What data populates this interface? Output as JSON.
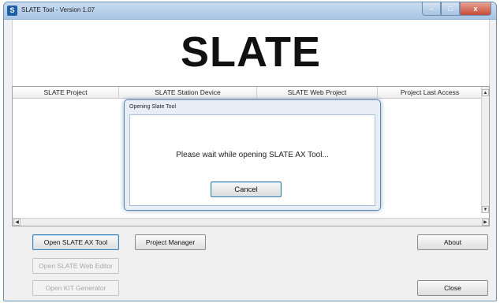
{
  "window": {
    "title": "SLATE Tool - Version 1.07",
    "app_icon_letter": "S",
    "controls": {
      "minimize": "–",
      "maximize": "□",
      "close": "x"
    }
  },
  "banner": {
    "title": "SLATE"
  },
  "list": {
    "columns": [
      "SLATE Project",
      "SLATE Station Device",
      "SLATE Web Project",
      "Project Last Access"
    ],
    "scroll_up": "▲",
    "scroll_down": "▼",
    "scroll_left": "◀",
    "scroll_right": "▶"
  },
  "dialog": {
    "title": "Opening Slate Tool",
    "message": "Please wait while opening SLATE AX Tool...",
    "cancel_label": "Cancel"
  },
  "buttons": {
    "open_ax": "Open SLATE AX Tool",
    "project_manager": "Project Manager",
    "about": "About",
    "open_web_editor": "Open SLATE Web Editor",
    "open_kit_generator": "Open KIT Generator",
    "close": "Close"
  }
}
